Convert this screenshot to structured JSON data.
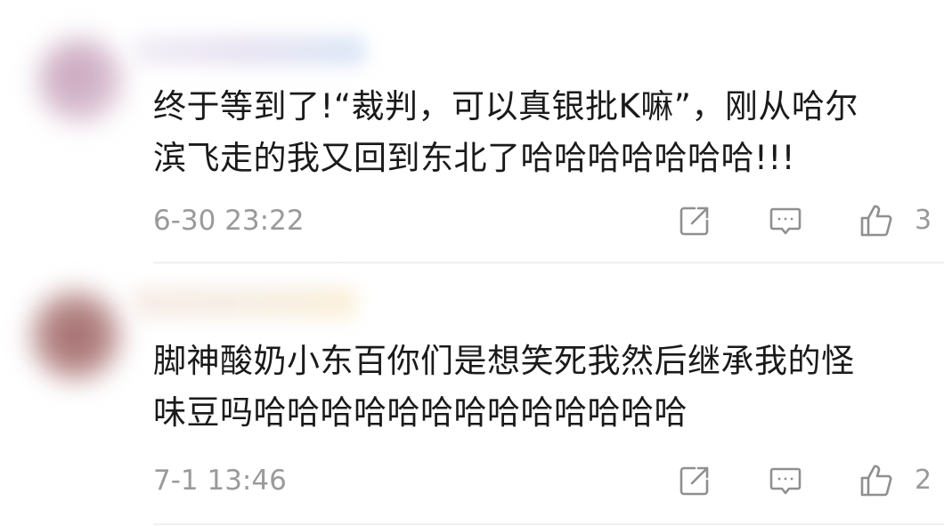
{
  "comments": [
    {
      "text_line1": "终于等到了!“裁判，可以真银批K嘛”，刚从哈尔",
      "text_line2": "滨飞走的我又回到东北了哈哈哈哈哈哈哈!!!",
      "timestamp": "6-30 23:22",
      "like_count": "3"
    },
    {
      "text_line1": "脚神酸奶小东百你们是想笑死我然后继承我的怪",
      "text_line2": "味豆吗哈哈哈哈哈哈哈哈哈哈哈哈哈",
      "timestamp": "7-1 13:46",
      "like_count": "2"
    }
  ],
  "icons": {
    "share": "share-icon",
    "reply": "comment-icon",
    "like": "thumbs-up-icon"
  },
  "colors": {
    "text": "#1a1a1a",
    "meta": "#9a9a9a",
    "icon": "#8f8f8f"
  }
}
